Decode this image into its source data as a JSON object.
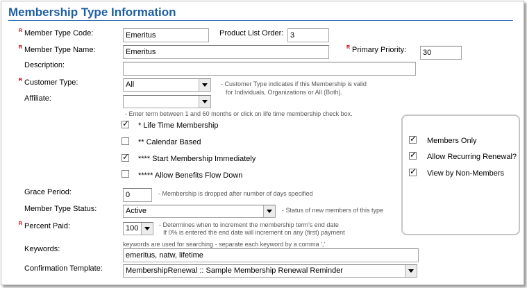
{
  "header": {
    "title": "Membership Type Information"
  },
  "required_marker": "R",
  "check_mark": "✓",
  "fields": {
    "member_type_code": {
      "label": "Member Type Code:",
      "value": "Emeritus"
    },
    "product_list_order": {
      "label": "Product List Order:",
      "value": "3"
    },
    "member_type_name": {
      "label": "Member Type Name:",
      "value": "Emeritus"
    },
    "primary_priority": {
      "label": "Primary Priority:",
      "value": "30"
    },
    "description": {
      "label": "Description:",
      "value": ""
    },
    "customer_type": {
      "label": "Customer Type:",
      "value": "All",
      "note_line1": "- Customer Type indicates if this Membership is valid",
      "note_line2": "for Individuals, Organizations or All (Both)."
    },
    "affiliate": {
      "label": "Affiliate:",
      "value": ""
    },
    "term_note": "- Enter term between 1 and 60 months or click on life time membership check box.",
    "grace_period": {
      "label": "Grace Period:",
      "value": "0",
      "note": "- Membership is dropped after number of days specified"
    },
    "member_type_status": {
      "label": "Member Type Status:",
      "value": "Active",
      "note": "- Status of new members of this type"
    },
    "percent_paid": {
      "label": "Percent Paid:",
      "value": "100",
      "note_line1": "- Determines when to increment the membership term's end date",
      "note_line2": "If 0% is entered the end date will increment on any (first) payment"
    },
    "keywords": {
      "label": "Keywords:",
      "note": "keywords are used for searching - separate each keyword by a comma ','",
      "value": "emeritus, natw, lifetime"
    },
    "confirmation_template": {
      "label": "Confirmation Template:",
      "value": "MembershipRenewal :: Sample Membership Renewal Reminder"
    }
  },
  "checkboxes": [
    {
      "label": "* Life Time Membership",
      "checked": true
    },
    {
      "label": "** Calendar Based",
      "checked": false
    },
    {
      "label": "**** Start Membership Immediately",
      "checked": true
    },
    {
      "label": "***** Allow Benefits Flow Down",
      "checked": false
    }
  ],
  "options_panel": [
    {
      "label": "Members Only",
      "checked": true
    },
    {
      "label": "Allow Recurring Renewal?",
      "checked": true
    },
    {
      "label": "View by Non-Members",
      "checked": true
    }
  ]
}
